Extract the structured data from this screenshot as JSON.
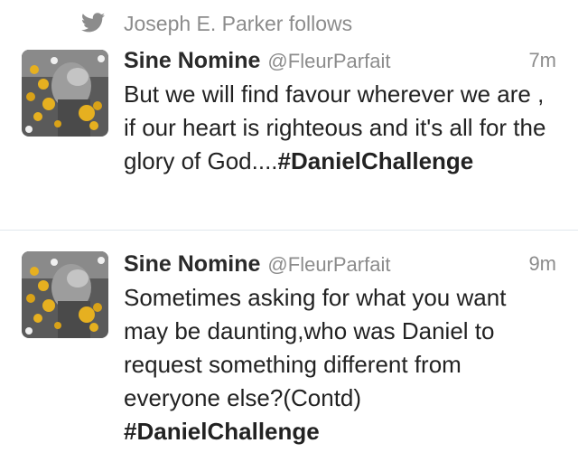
{
  "context": {
    "icon": "twitter-bird-icon",
    "text": "Joseph E. Parker follows"
  },
  "tweets": [
    {
      "name": "Sine Nomine",
      "handle": "@FleurParfait",
      "time": "7m",
      "text": "But we will find favour wherever we are , if our heart is righteous and it's all for the glory of God....",
      "hashtag": "#DanielChallenge"
    },
    {
      "name": "Sine Nomine",
      "handle": "@FleurParfait",
      "time": "9m",
      "text": "Sometimes asking for what you want may be daunting,who was Daniel to request something different from everyone else?(Contd) ",
      "hashtag": "#DanielChallenge"
    }
  ],
  "colors": {
    "muted": "#8c8c8c",
    "text": "#222222",
    "divider": "#e1e8ed",
    "flower": "#e6b020"
  }
}
